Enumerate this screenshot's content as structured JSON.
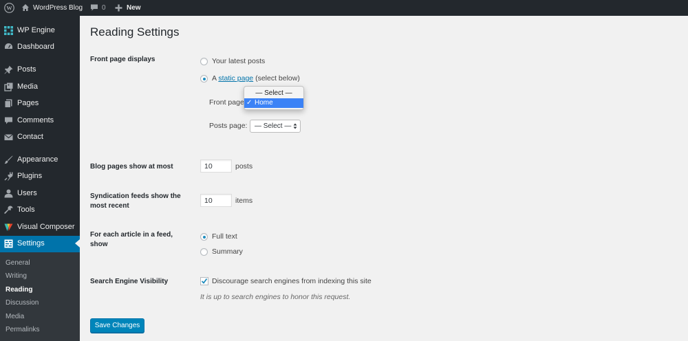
{
  "admin_bar": {
    "site_name": "WordPress Blog",
    "comments_count": "0",
    "new_label": "New"
  },
  "sidebar": {
    "items": [
      {
        "label": "WP Engine",
        "icon": "wpengine-icon"
      },
      {
        "label": "Dashboard",
        "icon": "dashboard-icon"
      },
      {
        "label": "Posts",
        "icon": "pin-icon"
      },
      {
        "label": "Media",
        "icon": "media-icon"
      },
      {
        "label": "Pages",
        "icon": "pages-icon"
      },
      {
        "label": "Comments",
        "icon": "comment-icon"
      },
      {
        "label": "Contact",
        "icon": "mail-icon"
      },
      {
        "label": "Appearance",
        "icon": "brush-icon"
      },
      {
        "label": "Plugins",
        "icon": "plug-icon"
      },
      {
        "label": "Users",
        "icon": "user-icon"
      },
      {
        "label": "Tools",
        "icon": "wrench-icon"
      },
      {
        "label": "Visual Composer",
        "icon": "visual-composer-icon"
      },
      {
        "label": "Settings",
        "icon": "settings-icon"
      }
    ],
    "submenu": [
      "General",
      "Writing",
      "Reading",
      "Discussion",
      "Media",
      "Permalinks"
    ],
    "active_item": "Settings",
    "current_submenu": "Reading"
  },
  "page": {
    "title": "Reading Settings",
    "front_page_displays": {
      "label": "Front page displays",
      "option_latest": "Your latest posts",
      "option_static_prefix": "A",
      "option_static_link": "static page",
      "option_static_suffix": "(select below)",
      "front_page_label": "Front page:",
      "posts_page_label": "Posts page:",
      "posts_page_value": "— Select —",
      "dropdown_options": [
        "— Select —",
        "Home"
      ],
      "dropdown_selected": "Home",
      "checkmark": "✓"
    },
    "blog_pages": {
      "label": "Blog pages show at most",
      "value": "10",
      "unit": "posts"
    },
    "syndication": {
      "label": "Syndication feeds show the most recent",
      "value": "10",
      "unit": "items"
    },
    "feed_article": {
      "label": "For each article in a feed, show",
      "option_full": "Full text",
      "option_summary": "Summary"
    },
    "search_visibility": {
      "label": "Search Engine Visibility",
      "checkbox_label": "Discourage search engines from indexing this site",
      "description": "It is up to search engines to honor this request."
    },
    "save_button": "Save Changes"
  },
  "colors": {
    "accent": "#0073aa",
    "admin_bg": "#23282d",
    "button": "#0085ba"
  }
}
